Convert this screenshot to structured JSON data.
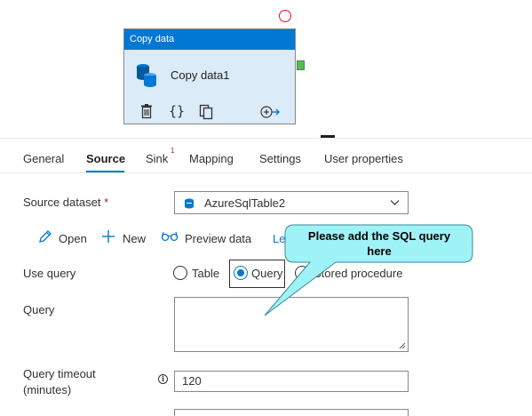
{
  "canvas": {
    "activity": {
      "type_label": "Copy data",
      "name": "Copy data1",
      "icons": [
        "delete-icon",
        "code-icon",
        "clone-icon",
        "add-output-icon",
        "database-icon"
      ]
    }
  },
  "tabs": [
    {
      "label": "General"
    },
    {
      "label": "Source"
    },
    {
      "label": "Sink",
      "badge": "1"
    },
    {
      "label": "Mapping"
    },
    {
      "label": "Settings"
    },
    {
      "label": "User properties"
    }
  ],
  "form": {
    "source_dataset_label": "Source dataset",
    "required_mark": "*",
    "source_dataset_value": "AzureSqlTable2",
    "actions": {
      "open": "Open",
      "new": "New",
      "preview": "Preview data",
      "learn_partial": "Le"
    },
    "use_query_label": "Use query",
    "use_query_options": [
      {
        "label": "Table",
        "selected": false
      },
      {
        "label": "Query",
        "selected": true
      },
      {
        "label": "Stored procedure",
        "selected": false
      }
    ],
    "query_label": "Query",
    "query_value": "",
    "timeout_label_line1": "Query timeout",
    "timeout_label_line2": "(minutes)",
    "timeout_value": "120"
  },
  "callout": {
    "line1": "Please add the SQL query",
    "line2": "here"
  },
  "colors": {
    "accent": "#0078d4",
    "activity_bg": "#dcebf8",
    "callout_fill": "#9ff3f7",
    "error": "#e81123",
    "success": "#5cb85c"
  }
}
